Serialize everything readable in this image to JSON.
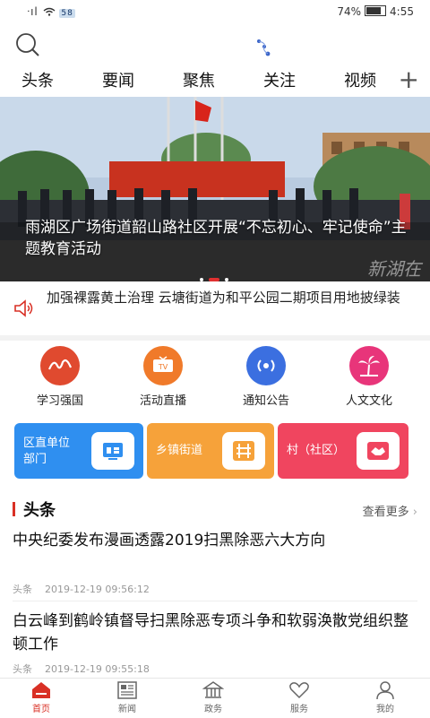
{
  "status_bar": {
    "signal": "ᐧıl",
    "speed": "58",
    "battery": "74%",
    "time": "4:55"
  },
  "tabs": [
    {
      "label": "头条"
    },
    {
      "label": "要闻"
    },
    {
      "label": "聚焦"
    },
    {
      "label": "关注"
    },
    {
      "label": "视频"
    }
  ],
  "tab_add": "+",
  "banner": {
    "caption": "雨湖区广场街道韶山路社区开展“不忘初心、牢记使命”主题教育活动",
    "watermark": "新湖在"
  },
  "notice": {
    "text": "加强裸露黄土治理 云塘街道为和平公园二期项目用地披绿装"
  },
  "quick_links": [
    {
      "label": "学习强国",
      "icon": "xuexi-icon",
      "color": "#e04a2f"
    },
    {
      "label": "活动直播",
      "icon": "tv-icon",
      "color": "#f07a2a"
    },
    {
      "label": "通知公告",
      "icon": "broadcast-icon",
      "color": "#3b6fe0"
    },
    {
      "label": "人文文化",
      "icon": "palm-icon",
      "color": "#e8357a"
    }
  ],
  "cards": [
    {
      "label_line1": "区直单位",
      "label_line2": "部门",
      "color": "#2f8ff0",
      "icon": "office-icon"
    },
    {
      "label_line1": "乡镇街道",
      "label_line2": "",
      "color": "#f6a23a",
      "icon": "road-icon"
    },
    {
      "label_line1": "村（社区）",
      "label_line2": "",
      "color": "#f0455f",
      "icon": "handshake-icon"
    }
  ],
  "news": {
    "section_title": "头条",
    "more_label": "查看更多",
    "articles": [
      {
        "title": "中央纪委发布漫画透露2019扫黑除恶六大方向",
        "tag": "头条",
        "time": "2019-12-19 09:56:12"
      },
      {
        "title": "白云峰到鹤岭镇督导扫黑除恶专项斗争和软弱涣散党组织整顿工作",
        "tag": "头条",
        "time": "2019-12-19 09:55:18"
      }
    ]
  },
  "bottom_nav": [
    {
      "label": "首页",
      "icon": "home-icon",
      "active": true
    },
    {
      "label": "新闻",
      "icon": "newspaper-icon",
      "active": false
    },
    {
      "label": "政务",
      "icon": "government-icon",
      "active": false
    },
    {
      "label": "服务",
      "icon": "heart-icon",
      "active": false
    },
    {
      "label": "我的",
      "icon": "user-icon",
      "active": false
    }
  ],
  "colors": {
    "accent": "#d93025"
  }
}
